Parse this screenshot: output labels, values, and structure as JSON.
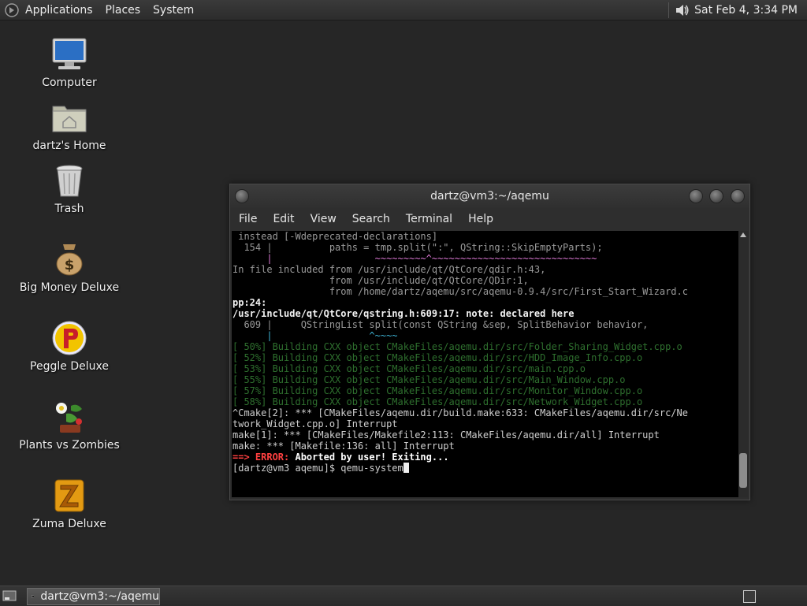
{
  "top_panel": {
    "menus": [
      "Applications",
      "Places",
      "System"
    ],
    "clock": "Sat Feb  4,  3:34 PM"
  },
  "desktop_icons": [
    {
      "label": "Computer",
      "icon": "computer-icon"
    },
    {
      "label": "dartz's Home",
      "icon": "home-folder-icon"
    },
    {
      "label": "Trash",
      "icon": "trash-icon"
    },
    {
      "label": "Big Money Deluxe",
      "icon": "money-bag-icon"
    },
    {
      "label": "Peggle Deluxe",
      "icon": "peggle-icon"
    },
    {
      "label": "Plants vs Zombies",
      "icon": "plants-vs-zombies-icon"
    },
    {
      "label": "Zuma Deluxe",
      "icon": "zuma-icon"
    }
  ],
  "terminal": {
    "title": "dartz@vm3:~/aqemu",
    "menu": [
      "File",
      "Edit",
      "View",
      "Search",
      "Terminal",
      "Help"
    ],
    "lines": [
      " instead [-Wdeprecated-declarations]",
      "  154 |          paths = tmp.split(\":\", QString::SkipEmptyParts);",
      "      |                  ~~~~~~~~~^~~~~~~~~~~~~~~~~~~~~~~~~~~~~~",
      "In file included from /usr/include/qt/QtCore/qdir.h:43,",
      "                 from /usr/include/qt/QtCore/QDir:1,",
      "                 from /home/dartz/aqemu/src/aqemu-0.9.4/src/First_Start_Wizard.c",
      "pp:24:",
      "/usr/include/qt/QtCore/qstring.h:609:17: note: declared here",
      "  609 |     QStringList split(const QString &sep, SplitBehavior behavior,",
      "      |                 ^~~~~",
      "[ 50%] Building CXX object CMakeFiles/aqemu.dir/src/Folder_Sharing_Widget.cpp.o",
      "[ 52%] Building CXX object CMakeFiles/aqemu.dir/src/HDD_Image_Info.cpp.o",
      "[ 53%] Building CXX object CMakeFiles/aqemu.dir/src/main.cpp.o",
      "[ 55%] Building CXX object CMakeFiles/aqemu.dir/src/Main_Window.cpp.o",
      "[ 57%] Building CXX object CMakeFiles/aqemu.dir/src/Monitor_Window.cpp.o",
      "[ 58%] Building CXX object CMakeFiles/aqemu.dir/src/Network_Widget.cpp.o",
      "^Cmake[2]: *** [CMakeFiles/aqemu.dir/build.make:633: CMakeFiles/aqemu.dir/src/Ne",
      "twork_Widget.cpp.o] Interrupt",
      "make[1]: *** [CMakeFiles/Makefile2:113: CMakeFiles/aqemu.dir/all] Interrupt",
      "make: *** [Makefile:136: all] Interrupt",
      "",
      "==> ERROR: Aborted by user! Exiting...",
      "",
      "[dartz@vm3 aqemu]$ qemu-system"
    ]
  },
  "taskbar": {
    "task_label": "dartz@vm3:~/aqemu"
  }
}
